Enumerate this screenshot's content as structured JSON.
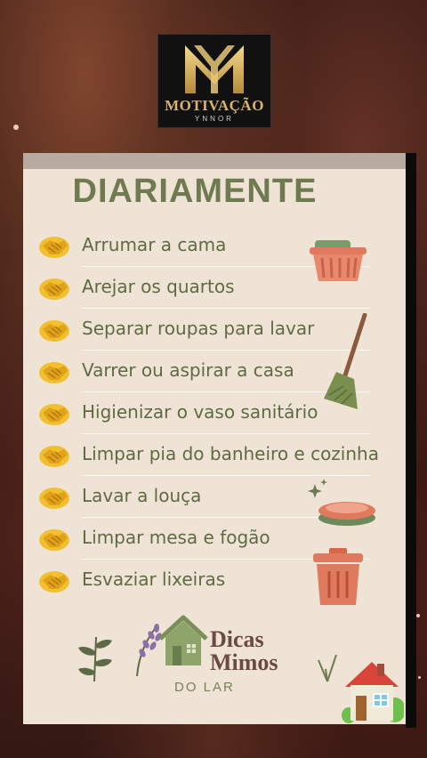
{
  "logo": {
    "brand": "MOTIVAÇÃO",
    "sub": "YNNOR",
    "monogram": "MY"
  },
  "card": {
    "title": "DIARIAMENTE",
    "tasks": [
      "Arrumar a cama",
      "Arejar os quartos",
      "Separar roupas para lavar",
      "Varrer ou aspirar a casa",
      "Higienizar o vaso sanitário",
      "Limpar pia do banheiro e cozinha",
      "Lavar a louça",
      "Limpar mesa e fogão",
      "Esvaziar lixeiras"
    ],
    "task_icon": "handshake-icon",
    "decorations": [
      "laundry-basket-icon",
      "broom-icon",
      "plates-sparkle-icon",
      "trash-bin-icon",
      "leaf-sprig-icon",
      "lavender-icon",
      "house-icon",
      "house-emoji-icon"
    ],
    "footer": {
      "line1": "Dicas",
      "line2": "Mimos",
      "sub": "DO LAR"
    }
  },
  "colors": {
    "accent": "#6f7a50",
    "card_bg": "#efe3d6",
    "brand_text": "#6b4a45",
    "basket": "#e07a5f"
  }
}
